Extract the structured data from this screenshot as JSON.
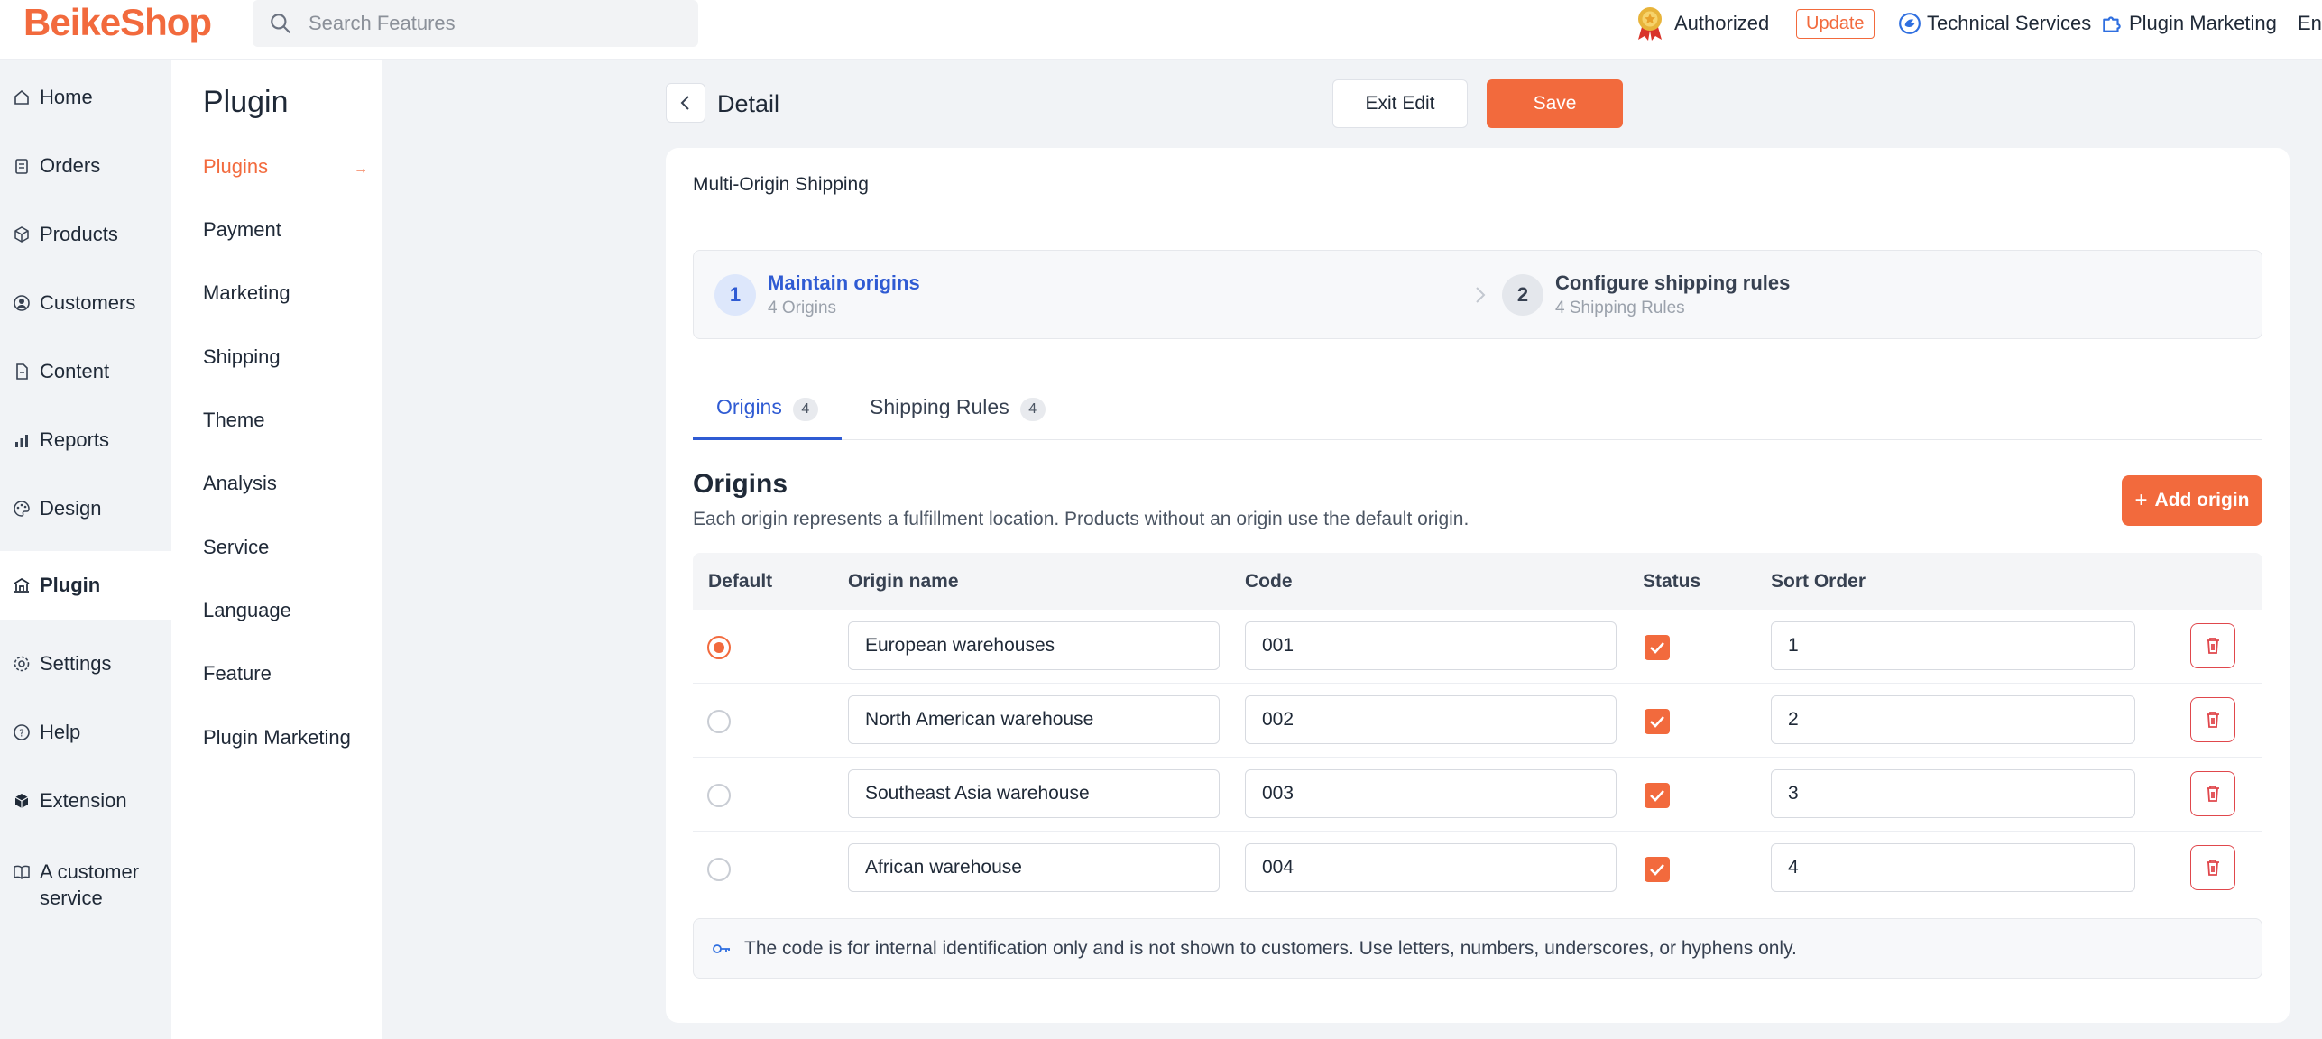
{
  "brand": {
    "logo_text": "BeikeShop",
    "accent": "#f26a3d",
    "link_blue": "#2f5bd3"
  },
  "topbar": {
    "search_placeholder": "Search Features",
    "authorized_label": "Authorized",
    "update_label": "Update",
    "technical_services_label": "Technical Services",
    "plugin_marketing_label": "Plugin Marketing",
    "language_label": "Eng"
  },
  "sidebar": {
    "items": [
      {
        "label": "Home",
        "icon": "home-icon"
      },
      {
        "label": "Orders",
        "icon": "clipboard-icon"
      },
      {
        "label": "Products",
        "icon": "box-icon"
      },
      {
        "label": "Customers",
        "icon": "user-circle-icon"
      },
      {
        "label": "Content",
        "icon": "document-icon"
      },
      {
        "label": "Reports",
        "icon": "bar-chart-icon"
      },
      {
        "label": "Design",
        "icon": "palette-icon"
      },
      {
        "label": "Plugin",
        "icon": "plugin-icon",
        "active": true
      },
      {
        "label": "Settings",
        "icon": "gear-icon"
      },
      {
        "label": "Help",
        "icon": "help-icon"
      },
      {
        "label": "Extension",
        "icon": "cube-icon"
      },
      {
        "label": "A customer service",
        "icon": "book-icon"
      }
    ]
  },
  "subnav": {
    "title": "Plugin",
    "items": [
      {
        "label": "Plugins",
        "active": true
      },
      {
        "label": "Payment"
      },
      {
        "label": "Marketing"
      },
      {
        "label": "Shipping"
      },
      {
        "label": "Theme"
      },
      {
        "label": "Analysis"
      },
      {
        "label": "Service"
      },
      {
        "label": "Language"
      },
      {
        "label": "Feature"
      },
      {
        "label": "Plugin Marketing"
      }
    ]
  },
  "header": {
    "title": "Detail",
    "exit_label": "Exit Edit",
    "save_label": "Save"
  },
  "card": {
    "title": "Multi-Origin Shipping",
    "steps": [
      {
        "number": "1",
        "title": "Maintain origins",
        "subtitle": "4 Origins",
        "active": true
      },
      {
        "number": "2",
        "title": "Configure shipping rules",
        "subtitle": "4 Shipping Rules",
        "active": false
      }
    ],
    "tabs": [
      {
        "label": "Origins",
        "count": "4",
        "active": true
      },
      {
        "label": "Shipping Rules",
        "count": "4",
        "active": false
      }
    ],
    "section_title": "Origins",
    "section_desc": "Each origin represents a fulfillment location. Products without an origin use the default origin.",
    "add_label": "Add origin",
    "columns": [
      "Default",
      "Origin name",
      "Code",
      "Status",
      "Sort Order"
    ],
    "rows": [
      {
        "default": true,
        "name": "European warehouses",
        "code": "001",
        "status": true,
        "sort": "1"
      },
      {
        "default": false,
        "name": "North American warehouse",
        "code": "002",
        "status": true,
        "sort": "2"
      },
      {
        "default": false,
        "name": "Southeast Asia warehouse",
        "code": "003",
        "status": true,
        "sort": "3"
      },
      {
        "default": false,
        "name": "African warehouse",
        "code": "004",
        "status": true,
        "sort": "4"
      }
    ],
    "note": "The code is for internal identification only and is not shown to customers. Use letters, numbers, underscores, or hyphens only."
  }
}
